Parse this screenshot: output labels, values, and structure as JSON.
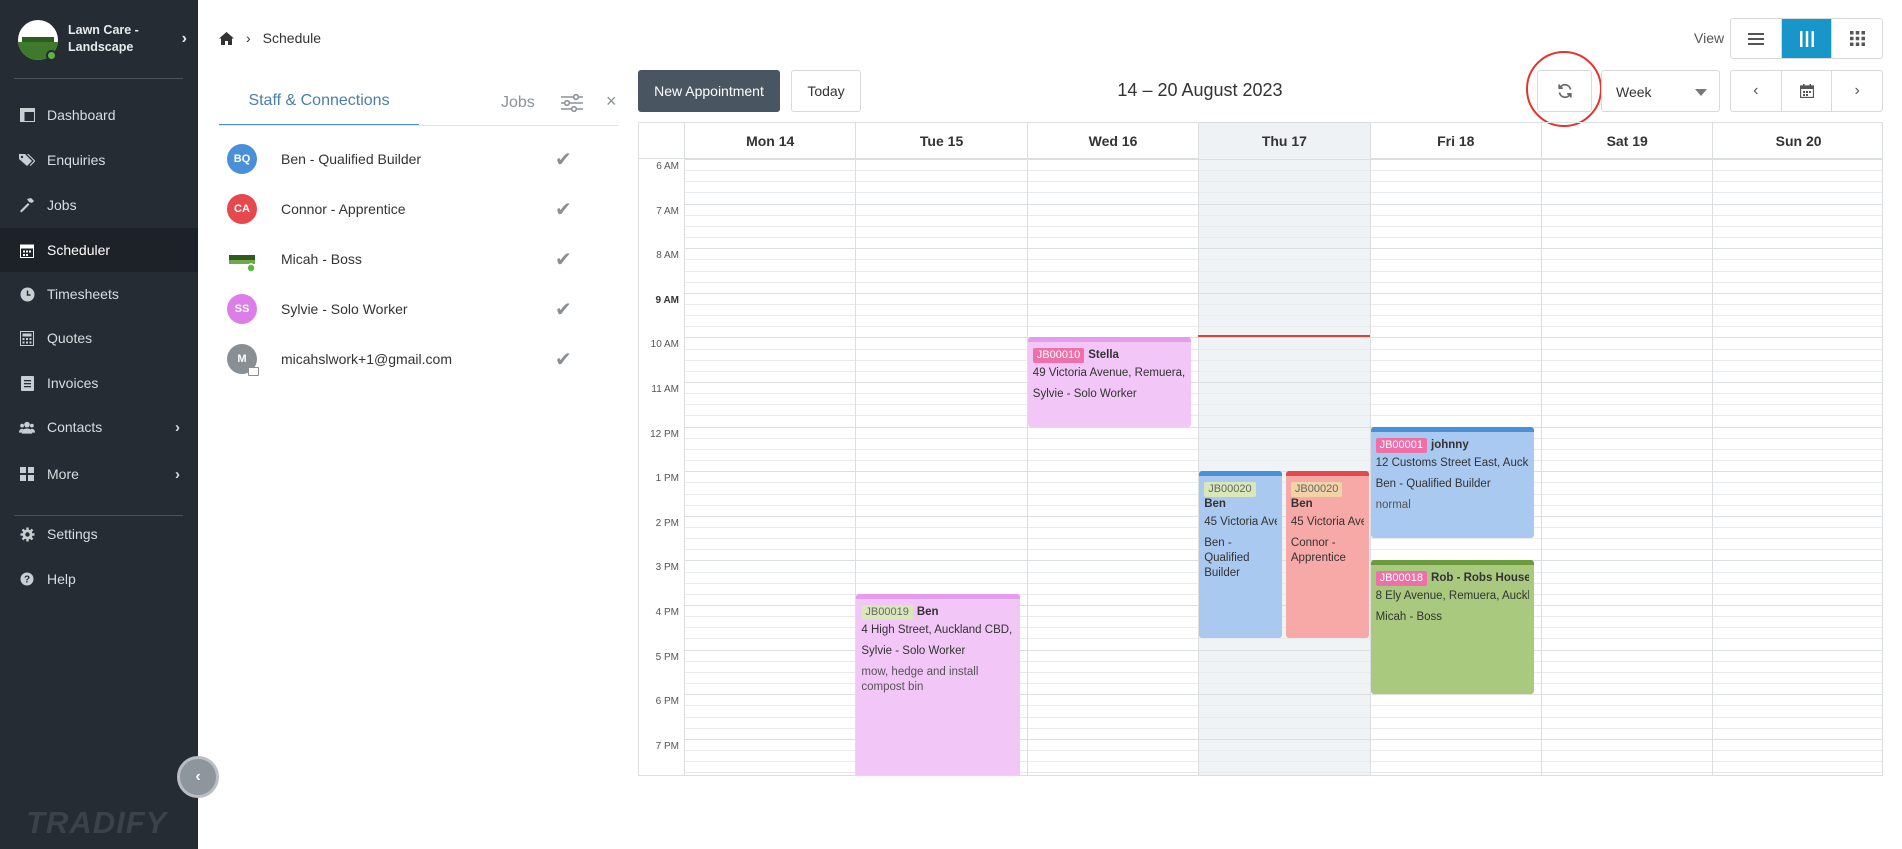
{
  "app": {
    "brand_name": "Lawn Care - Landscape",
    "brand_logo_text": "LAWN CARE",
    "footer_brand": "TRADIFY"
  },
  "sidebar": {
    "items": [
      {
        "label": "Dashboard",
        "icon": "dashboard-icon"
      },
      {
        "label": "Enquiries",
        "icon": "tag-icon"
      },
      {
        "label": "Jobs",
        "icon": "hammer-icon"
      },
      {
        "label": "Scheduler",
        "icon": "calendar-icon",
        "active": true
      },
      {
        "label": "Timesheets",
        "icon": "clock-icon"
      },
      {
        "label": "Quotes",
        "icon": "calculator-icon"
      },
      {
        "label": "Invoices",
        "icon": "invoice-icon"
      },
      {
        "label": "Contacts",
        "icon": "users-icon",
        "has_submenu": true
      },
      {
        "label": "More",
        "icon": "grid-icon",
        "has_submenu": true
      },
      {
        "label": "Settings",
        "icon": "gear-icon"
      },
      {
        "label": "Help",
        "icon": "help-icon"
      }
    ]
  },
  "breadcrumb": {
    "current": "Schedule"
  },
  "view": {
    "label": "View",
    "options": [
      "list",
      "week-columns",
      "grid"
    ],
    "selected": "week-columns"
  },
  "panel": {
    "tab_staff": "Staff & Connections",
    "tab_jobs": "Jobs",
    "staff": [
      {
        "initials": "BQ",
        "name": "Ben - Qualified Builder",
        "color": "#4a90d9",
        "checked": true
      },
      {
        "initials": "CA",
        "name": "Connor - Apprentice",
        "color": "#e5484d",
        "checked": true
      },
      {
        "initials": "",
        "name": "Micah - Boss",
        "color": "#3f7a2c",
        "checked": true,
        "logo": true
      },
      {
        "initials": "SS",
        "name": "Sylvie - Solo Worker",
        "color": "#dd7ee8",
        "checked": true
      },
      {
        "initials": "M",
        "name": "micahslwork+1@gmail.com",
        "color": "#8a8f94",
        "checked": true
      }
    ]
  },
  "toolbar": {
    "new_appointment": "New Appointment",
    "today": "Today",
    "range_title": "14 – 20 August 2023",
    "period": "Week"
  },
  "calendar": {
    "days": [
      "Mon 14",
      "Tue 15",
      "Wed 16",
      "Thu 17",
      "Fri 18",
      "Sat 19",
      "Sun 20"
    ],
    "today_index": 3,
    "times": [
      "6 AM",
      "7 AM",
      "8 AM",
      "9 AM",
      "10 AM",
      "11 AM",
      "12 PM",
      "1 PM",
      "2 PM",
      "3 PM",
      "4 PM",
      "5 PM",
      "6 PM",
      "7 PM"
    ],
    "bold_time": "9 AM",
    "events": [
      {
        "job": "JB00010",
        "title": "Stella",
        "address": "49 Victoria Avenue, Remuera, A",
        "staff": "Sylvie - Solo Worker",
        "note": "",
        "day": 2,
        "start": 10.0,
        "end": 12.0,
        "bg": "#f2c6f7",
        "top": "#e59bee",
        "tag_bg": "#ef6fa8",
        "tag_fg": "#ffffff"
      },
      {
        "job": "JB00019",
        "title": "Ben",
        "address": "4 High Street, Auckland CBD, A",
        "staff": "Sylvie - Solo Worker",
        "note": "mow, hedge and install compost bin",
        "day": 1,
        "start": 15.75,
        "end": 20.0,
        "bg": "#f2c6f7",
        "top": "#e59bee",
        "tag_bg": "#d9e8b9",
        "tag_fg": "#666666"
      },
      {
        "job": "JB00020",
        "title": "Ben",
        "address": "45 Victoria Ave",
        "staff": "Ben - Qualified Builder",
        "note": "",
        "day": 3,
        "start": 13.0,
        "end": 16.75,
        "bg": "#a9c9f0",
        "top": "#4a90d9",
        "tag_bg": "#d9e8b9",
        "tag_fg": "#666666",
        "half": 0
      },
      {
        "job": "JB00020",
        "title": "Ben",
        "address": "45 Victoria Ave",
        "staff": "Connor - Apprentice",
        "note": "",
        "day": 3,
        "start": 13.0,
        "end": 16.75,
        "bg": "#f7a9a8",
        "top": "#e5484d",
        "tag_bg": "#f1d3a8",
        "tag_fg": "#666666",
        "half": 1
      },
      {
        "job": "JB00001",
        "title": "johnny",
        "address": "12 Customs Street East, Auckl",
        "staff": "Ben - Qualified Builder",
        "note": "normal",
        "day": 4,
        "start": 12.0,
        "end": 14.5,
        "bg": "#a9c9f0",
        "top": "#4a90d9",
        "tag_bg": "#ef6fa8",
        "tag_fg": "#ffffff"
      },
      {
        "job": "JB00018",
        "title": "Rob - Robs House",
        "address": "8 Ely Avenue, Remuera, Auckla",
        "staff": "Micah - Boss",
        "note": "",
        "day": 4,
        "start": 15.0,
        "end": 18.0,
        "bg": "#a9c97f",
        "top": "#6a9c3c",
        "tag_bg": "#ef6fa8",
        "tag_fg": "#ffffff"
      }
    ]
  },
  "colors": {
    "sidebar_bg": "#252c33",
    "accent": "#1895c9",
    "now_line": "#d9423a",
    "highlight": "#e5322d"
  }
}
